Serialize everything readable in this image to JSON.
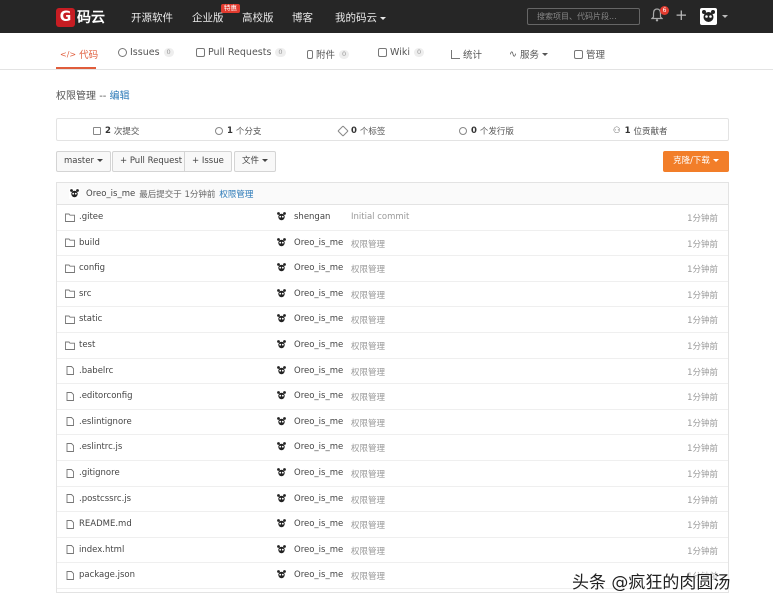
{
  "topbar": {
    "logo_mark": "G",
    "logo_text": "码云",
    "nav": [
      "开源软件",
      "企业版",
      "高校版",
      "博客",
      "我的码云"
    ],
    "enterprise_badge": "特惠",
    "search_placeholder": "搜索项目、代码片段...",
    "notification_count": "6"
  },
  "tabs": [
    {
      "label": "代码",
      "count": ""
    },
    {
      "label": "Issues",
      "count": "0"
    },
    {
      "label": "Pull Requests",
      "count": "0"
    },
    {
      "label": "附件",
      "count": "0"
    },
    {
      "label": "Wiki",
      "count": "0"
    },
    {
      "label": "统计",
      "count": ""
    },
    {
      "label": "服务",
      "count": ""
    },
    {
      "label": "管理",
      "count": ""
    }
  ],
  "breadcrumb": {
    "repo": "权限管理",
    "sep": "--",
    "action": "编辑"
  },
  "stats": [
    {
      "value": "2",
      "label": "次提交"
    },
    {
      "value": "1",
      "label": "个分支"
    },
    {
      "value": "0",
      "label": "个标签"
    },
    {
      "value": "0",
      "label": "个发行版"
    },
    {
      "value": "1",
      "label": "位贡献者"
    }
  ],
  "actions": {
    "branch": "master",
    "pull_request": "+ Pull Request",
    "issue": "+ Issue",
    "file": "文件",
    "clone": "克隆/下载"
  },
  "last_commit": {
    "author": "Oreo_is_me",
    "text": "最后提交于",
    "time": "1分钟前",
    "message": "权限管理"
  },
  "files": [
    {
      "name": ".gitee",
      "type": "folder",
      "author": "shengan",
      "message": "Initial commit",
      "time": "1分钟前"
    },
    {
      "name": "build",
      "type": "folder",
      "author": "Oreo_is_me",
      "message": "权限管理",
      "time": "1分钟前"
    },
    {
      "name": "config",
      "type": "folder",
      "author": "Oreo_is_me",
      "message": "权限管理",
      "time": "1分钟前"
    },
    {
      "name": "src",
      "type": "folder",
      "author": "Oreo_is_me",
      "message": "权限管理",
      "time": "1分钟前"
    },
    {
      "name": "static",
      "type": "folder",
      "author": "Oreo_is_me",
      "message": "权限管理",
      "time": "1分钟前"
    },
    {
      "name": "test",
      "type": "folder",
      "author": "Oreo_is_me",
      "message": "权限管理",
      "time": "1分钟前"
    },
    {
      "name": ".babelrc",
      "type": "file",
      "author": "Oreo_is_me",
      "message": "权限管理",
      "time": "1分钟前"
    },
    {
      "name": ".editorconfig",
      "type": "file",
      "author": "Oreo_is_me",
      "message": "权限管理",
      "time": "1分钟前"
    },
    {
      "name": ".eslintignore",
      "type": "file",
      "author": "Oreo_is_me",
      "message": "权限管理",
      "time": "1分钟前"
    },
    {
      "name": ".eslintrc.js",
      "type": "file",
      "author": "Oreo_is_me",
      "message": "权限管理",
      "time": "1分钟前"
    },
    {
      "name": ".gitignore",
      "type": "file",
      "author": "Oreo_is_me",
      "message": "权限管理",
      "time": "1分钟前"
    },
    {
      "name": ".postcssrc.js",
      "type": "file",
      "author": "Oreo_is_me",
      "message": "权限管理",
      "time": "1分钟前"
    },
    {
      "name": "README.md",
      "type": "file",
      "author": "Oreo_is_me",
      "message": "权限管理",
      "time": "1分钟前"
    },
    {
      "name": "index.html",
      "type": "file",
      "author": "Oreo_is_me",
      "message": "权限管理",
      "time": "1分钟前"
    },
    {
      "name": "package.json",
      "type": "file",
      "author": "Oreo_is_me",
      "message": "权限管理",
      "time": "1分钟前"
    }
  ],
  "watermark": "头条 @疯狂的肉圆汤",
  "colors": {
    "topbar": "#262626",
    "brand": "#c71d23",
    "accent": "#e05d3b",
    "clone_button": "#f27e29",
    "link": "#2c7ab8"
  }
}
